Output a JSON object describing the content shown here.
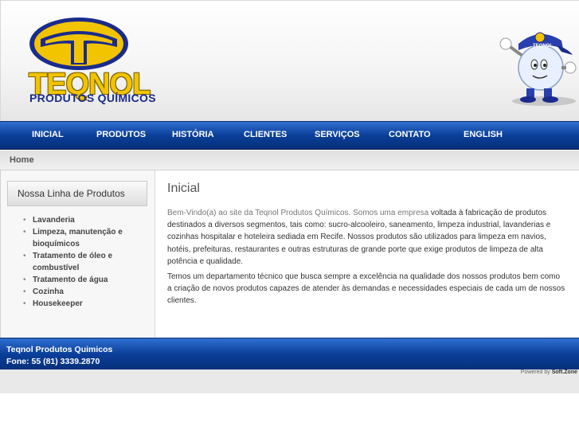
{
  "header": {
    "brand_name": "TEQNOL",
    "brand_tagline": "PRODUTOS QUÍMICOS",
    "mascot_cap_text": "TEQNOL"
  },
  "nav": {
    "items": [
      {
        "label": "INICIAL"
      },
      {
        "label": "PRODUTOS"
      },
      {
        "label": "HISTÓRIA"
      },
      {
        "label": "CLIENTES"
      },
      {
        "label": "SERVIÇOS"
      },
      {
        "label": "CONTATO"
      },
      {
        "label": "ENGLISH"
      }
    ]
  },
  "breadcrumb": {
    "home": "Home"
  },
  "sidebar": {
    "title": "Nossa Linha de Produtos",
    "items": [
      {
        "label": "Lavanderia"
      },
      {
        "label": "Limpeza, manutenção e bioquímicos"
      },
      {
        "label": "Tratamento de óleo e combustível"
      },
      {
        "label": "Tratamento de água"
      },
      {
        "label": "Cozinha"
      },
      {
        "label": "Housekeeper"
      }
    ]
  },
  "main": {
    "title": "Inicial",
    "para1_lead": "Bem-Vindo(a) ao site da Teqnol Produtos Químicos. Somos uma empresa",
    "para1_rest": " voltada à fabricação de produtos destinados a diversos segmentos, tais como: sucro-alcooleiro, saneamento, limpeza industrial, lavanderias e cozinhas hospitalar e hoteleira sediada em Recife. Nossos produtos são utilizados para limpeza em navios, hotéis, prefeituras, restaurantes e outras estruturas de grande porte que exige produtos de limpeza de alta potência e qualidade.",
    "para2": "Temos um departamento técnico que busca sempre a excelência na qualidade dos nossos produtos bem como a criação de novos produtos capazes de atender às demandas e necessidades especiais de cada um de nossos clientes."
  },
  "footer": {
    "company": "Teqnol Produtos Quimicos",
    "phone": "Fone: 55 (81) 3339.2870"
  },
  "powered": {
    "prefix": "Powered by ",
    "name": "Soft.Zone"
  },
  "colors": {
    "nav_blue": "#0b3f99",
    "logo_yellow": "#f2c400",
    "logo_navy": "#1b2b8c"
  }
}
